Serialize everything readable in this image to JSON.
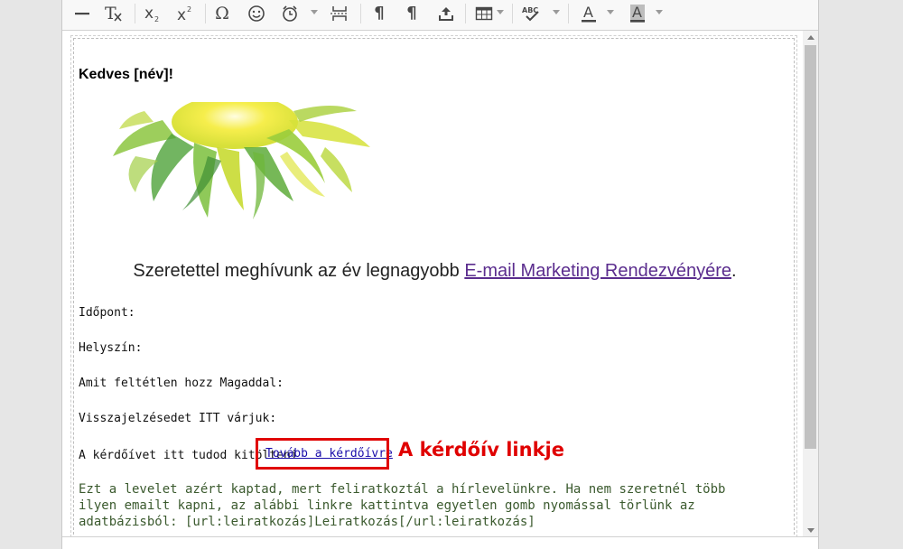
{
  "toolbar": {
    "items": [
      {
        "name": "horizontal-line",
        "icon": "horizontal-line-icon"
      },
      {
        "name": "remove-format",
        "icon": "remove-format-icon",
        "glyph": "T"
      },
      {
        "name": "subscript",
        "icon": "subscript-icon",
        "glyph": "X"
      },
      {
        "name": "superscript",
        "icon": "superscript-icon",
        "glyph": "X"
      },
      {
        "name": "special-char",
        "icon": "omega-icon",
        "glyph": "Ω"
      },
      {
        "name": "emoji",
        "icon": "smiley-icon",
        "glyph": "☺"
      },
      {
        "name": "timer",
        "icon": "alarm-clock-icon"
      },
      {
        "name": "page-break",
        "icon": "page-break-icon"
      },
      {
        "name": "paragraph-ltr",
        "icon": "paragraph-icon",
        "glyph": "¶"
      },
      {
        "name": "paragraph-rtl",
        "icon": "paragraph-icon",
        "glyph": "¶"
      },
      {
        "name": "upload",
        "icon": "upload-icon"
      },
      {
        "name": "table",
        "icon": "table-icon"
      },
      {
        "name": "spellcheck",
        "icon": "spellcheck-icon",
        "glyph": "ABC"
      },
      {
        "name": "text-color",
        "icon": "text-color-icon",
        "glyph": "A"
      },
      {
        "name": "bg-color",
        "icon": "background-color-icon",
        "glyph": "A"
      }
    ]
  },
  "content": {
    "greeting": "Kedves [név]!",
    "invite_text": "Szeretettel meghívunk az év legnagyobb ",
    "invite_link": "E-mail Marketing Rendezvényére",
    "invite_end": ".",
    "fields": [
      "Időpont:",
      "Helyszín:",
      "Amit feltétlen hozz Magaddal:",
      "Visszajelzésedet ITT várjuk:"
    ],
    "questionnaire_label": "A kérdőívet itt tudod kitölteni",
    "questionnaire_link": "Tovább a kérdőívre",
    "footer": "Ezt a levelet azért kaptad, mert feliratkoztál a hírlevelünkre. Ha nem szeretnél több ilyen emailt kapni, az alábbi linkre kattintva egyetlen gomb nyomással törlünk az adatbázisból: [url:leiratkozás]Leiratkozás[/url:leiratkozás]"
  },
  "annotation": {
    "label": "A kérdőív linkje",
    "color": "#e00000"
  },
  "colors": {
    "link_purple": "#5b2d8e",
    "link_blue": "#1a0dab",
    "footer_text": "#3b5a2e"
  }
}
